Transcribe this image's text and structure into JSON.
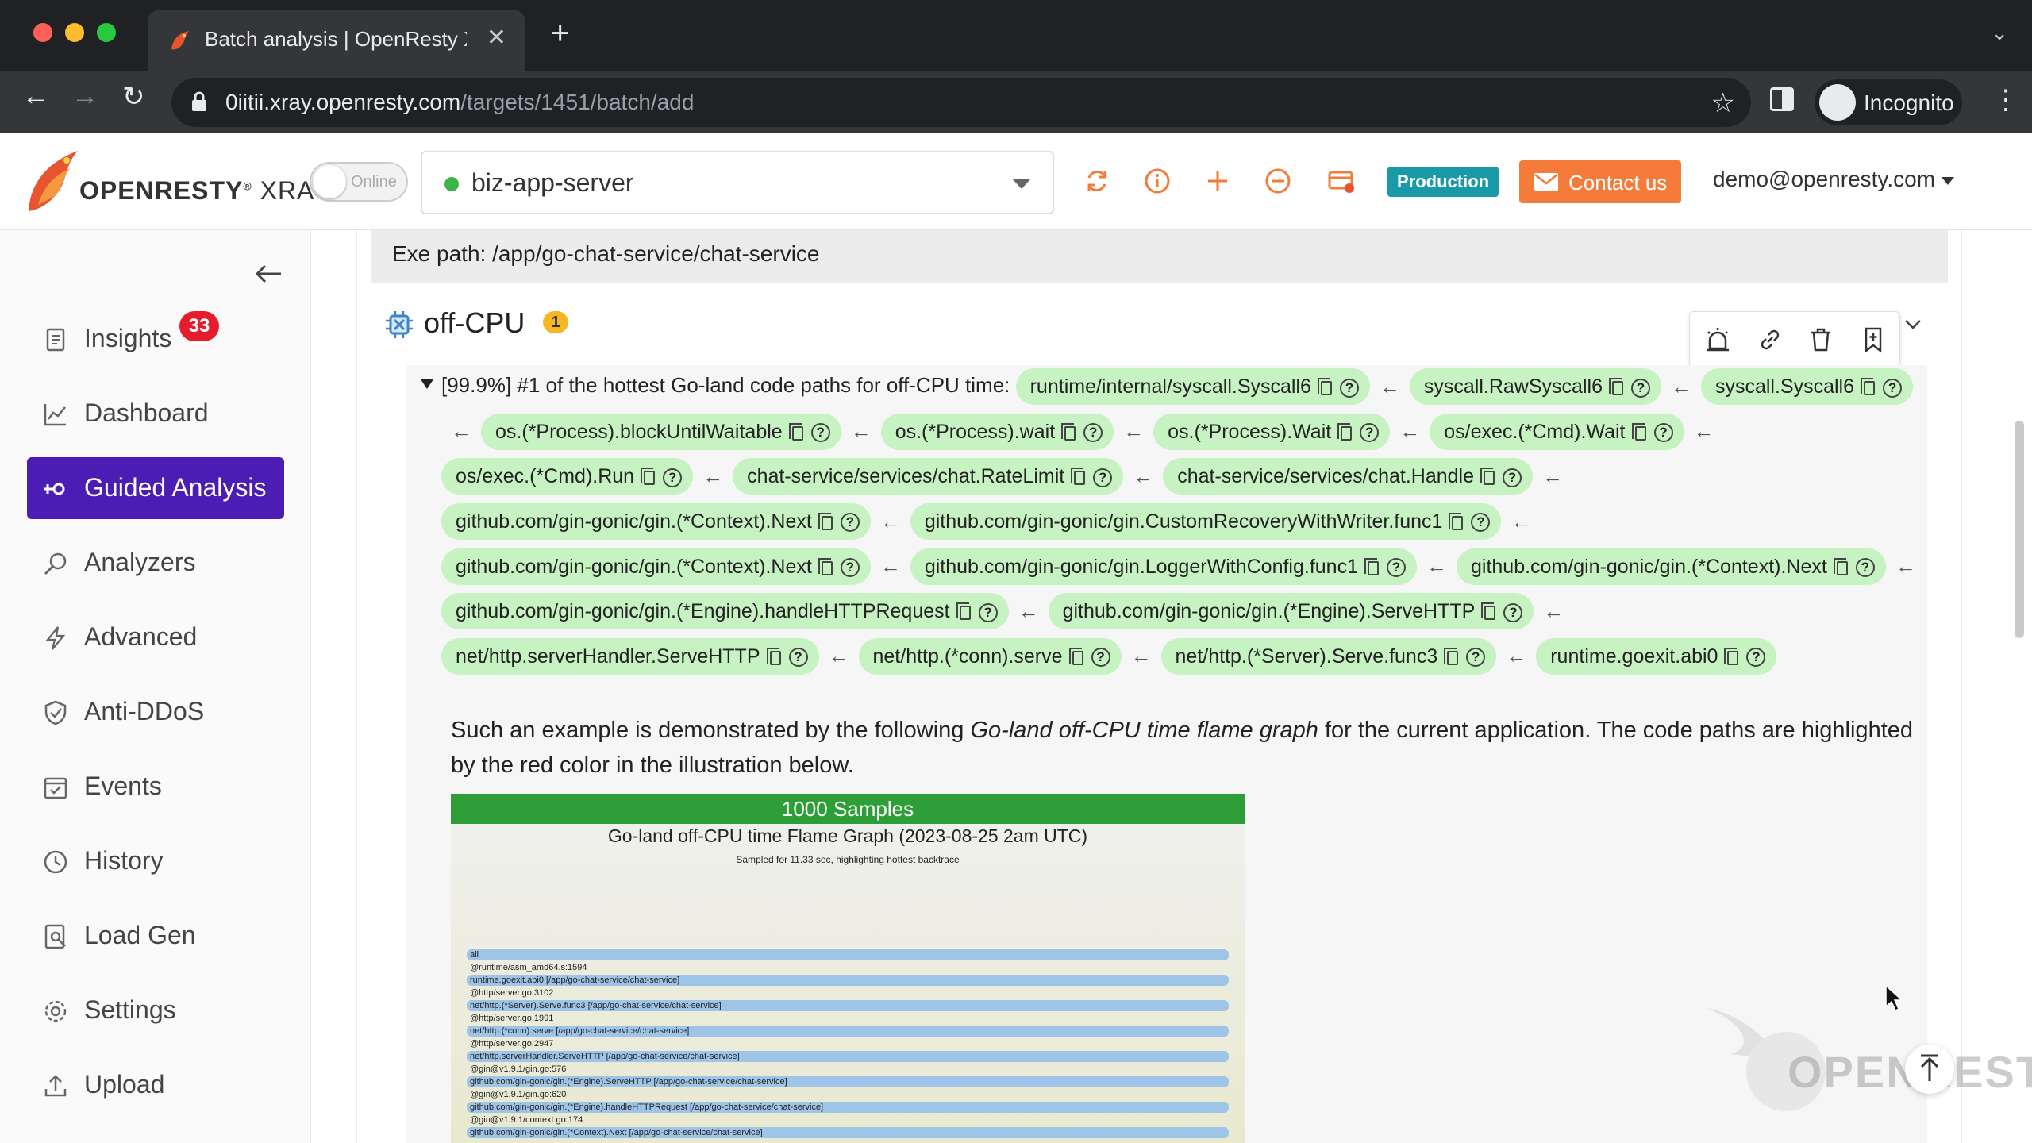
{
  "browser": {
    "tab_title": "Batch analysis | OpenResty XRay",
    "url_host": "0iitii.xray.openresty.com",
    "url_path": "/targets/1451/batch/add",
    "profile_label": "Incognito"
  },
  "header": {
    "logo_text_main": "OPENRESTY",
    "logo_text_suffix": "XRAY",
    "toggle_label": "Online",
    "target_name": "biz-app-server",
    "target_status_color": "#39b54a",
    "env_badge": "Production",
    "contact_label": "Contact us",
    "user_email": "demo@openresty.com",
    "icons": [
      "refresh-icon",
      "info-icon",
      "plus-icon",
      "minus-circle-icon",
      "card-icon"
    ]
  },
  "sidebar": {
    "items": [
      {
        "label": "Insights",
        "icon": "insights-icon",
        "badge": "33"
      },
      {
        "label": "Dashboard",
        "icon": "chart-icon"
      },
      {
        "label": "Guided Analysis",
        "icon": "guided-icon",
        "active": true
      },
      {
        "label": "Analyzers",
        "icon": "analyzers-icon"
      },
      {
        "label": "Advanced",
        "icon": "bolt-icon"
      },
      {
        "label": "Anti-DDoS",
        "icon": "shield-icon"
      },
      {
        "label": "Events",
        "icon": "calendar-icon"
      },
      {
        "label": "History",
        "icon": "clock-icon"
      },
      {
        "label": "Load Gen",
        "icon": "loadgen-icon"
      },
      {
        "label": "Settings",
        "icon": "gear-icon"
      },
      {
        "label": "Upload",
        "icon": "upload-icon"
      }
    ],
    "active_color": "#4c1db5"
  },
  "main": {
    "exe_path": "Exe path: /app/go-chat-service/chat-service",
    "section_title": "off-CPU",
    "section_count": "1",
    "lead_percent": "[99.9%]",
    "lead_text": "#1 of the hottest Go-land code paths for off-CPU time:",
    "frames": [
      "runtime/internal/syscall.Syscall6",
      "syscall.RawSyscall6",
      "syscall.Syscall6",
      "os.(*Process).blockUntilWaitable",
      "os.(*Process).wait",
      "os.(*Process).Wait",
      "os/exec.(*Cmd).Wait",
      "os/exec.(*Cmd).Run",
      "chat-service/services/chat.RateLimit",
      "chat-service/services/chat.Handle",
      "github.com/gin-gonic/gin.(*Context).Next",
      "github.com/gin-gonic/gin.CustomRecoveryWithWriter.func1",
      "github.com/gin-gonic/gin.(*Context).Next",
      "github.com/gin-gonic/gin.LoggerWithConfig.func1",
      "github.com/gin-gonic/gin.(*Context).Next",
      "github.com/gin-gonic/gin.(*Engine).handleHTTPRequest",
      "github.com/gin-gonic/gin.(*Engine).ServeHTTP",
      "net/http.serverHandler.ServeHTTP",
      "net/http.(*conn).serve",
      "net/http.(*Server).Serve.func3",
      "runtime.goexit.abi0"
    ],
    "desc_pre": "Such an example is demonstrated by the following ",
    "desc_em": "Go-land off-CPU time flame graph",
    "desc_post": " for the current application. The code paths are highlighted by the red color in the illustration below.",
    "flame": {
      "header": "1000 Samples",
      "title": "Go-land off-CPU time Flame Graph (2023-08-25 2am UTC)",
      "subtitle": "Sampled for 11.33 sec, highlighting hottest backtrace",
      "rows": [
        "all",
        "@runtime/asm_amd64.s:1594",
        "runtime.goexit.abi0 [/app/go-chat-service/chat-service]",
        "@http/server.go:3102",
        "net/http.(*Server).Serve.func3 [/app/go-chat-service/chat-service]",
        "@http/server.go:1991",
        "net/http.(*conn).serve [/app/go-chat-service/chat-service]",
        "@http/server.go:2947",
        "net/http.serverHandler.ServeHTTP [/app/go-chat-service/chat-service]",
        "@gin@v1.9.1/gin.go:576",
        "github.com/gin-gonic/gin.(*Engine).ServeHTTP [/app/go-chat-service/chat-service]",
        "@gin@v1.9.1/gin.go:620",
        "github.com/gin-gonic/gin.(*Engine).handleHTTPRequest [/app/go-chat-service/chat-service]",
        "@gin@v1.9.1/context.go:174",
        "github.com/gin-gonic/gin.(*Context).Next [/app/go-chat-service/chat-service]"
      ],
      "header_color": "#2e9e38",
      "frame_color": "#9ec4e8"
    }
  },
  "watermark_text": "OPENRESTY"
}
